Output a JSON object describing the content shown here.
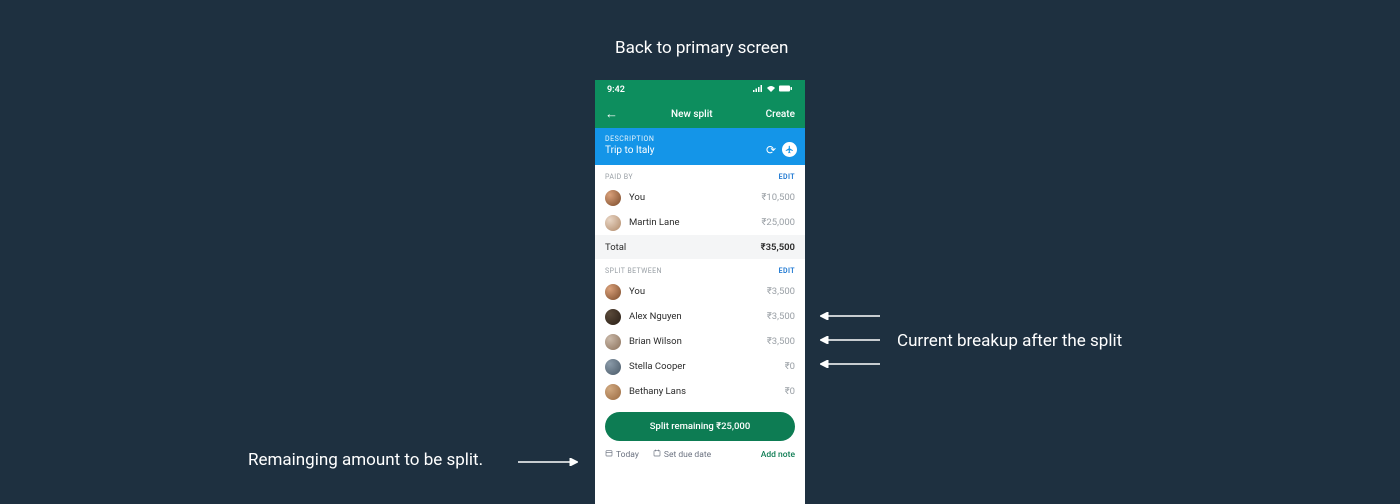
{
  "annotations": {
    "top": "Back to primary screen",
    "right": "Current breakup after the split",
    "left": "Remainging amount to be split."
  },
  "statusbar": {
    "time": "9:42"
  },
  "navbar": {
    "back": "←",
    "title": "New split",
    "action": "Create"
  },
  "description": {
    "label": "DESCRIPTION",
    "value": "Trip to Italy"
  },
  "paidby": {
    "label": "PAID BY",
    "edit": "EDIT",
    "rows": [
      {
        "name": "You",
        "amount": "₹10,500"
      },
      {
        "name": "Martin Lane",
        "amount": "₹25,000"
      }
    ],
    "total_label": "Total",
    "total_amount": "₹35,500"
  },
  "split": {
    "label": "SPLIT BETWEEN",
    "edit": "EDIT",
    "rows": [
      {
        "name": "You",
        "amount": "₹3,500"
      },
      {
        "name": "Alex Nguyen",
        "amount": "₹3,500"
      },
      {
        "name": "Brian Wilson",
        "amount": "₹3,500"
      },
      {
        "name": "Stella Cooper",
        "amount": "₹0"
      },
      {
        "name": "Bethany Lans",
        "amount": "₹0"
      }
    ]
  },
  "cta": "Split remaining ₹25,000",
  "footer": {
    "today": "Today",
    "duedate": "Set due date",
    "addnote": "Add note"
  }
}
